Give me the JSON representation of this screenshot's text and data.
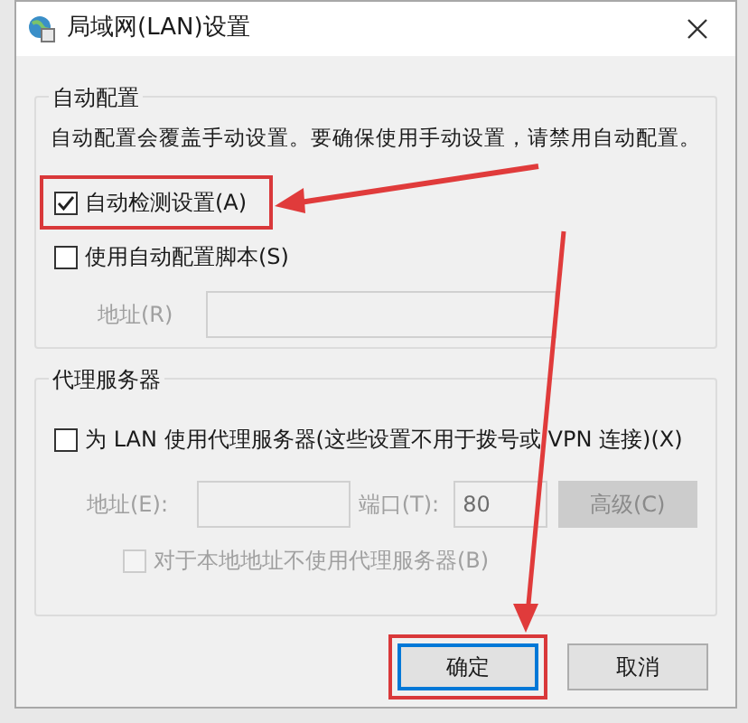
{
  "window": {
    "title": "局域网(LAN)设置"
  },
  "auto_config": {
    "title": "自动配置",
    "description": "自动配置会覆盖手动设置。要确保使用手动设置，请禁用自动配置。",
    "options": [
      {
        "label": "自动检测设置(A)",
        "checked": true,
        "highlighted": true
      },
      {
        "label": "使用自动配置脚本(S)",
        "checked": false,
        "highlighted": false
      }
    ],
    "address": {
      "label": "地址(R)",
      "disabled": true
    }
  },
  "proxy": {
    "title": "代理服务器",
    "use_proxy": {
      "label": "为 LAN 使用代理服务器(这些设置不用于拨号或 VPN 连接)(X)",
      "checked": false
    },
    "address": {
      "label": "地址(E):",
      "disabled": true
    },
    "port": {
      "label": "端口(T):",
      "value": "80",
      "disabled": true
    },
    "advanced": {
      "label": "高级(C)",
      "disabled": true
    },
    "bypass": {
      "label": "对于本地地址不使用代理服务器(B)",
      "checked": false,
      "disabled": true
    }
  },
  "buttons": [
    {
      "label": "确定",
      "focused": true,
      "highlighted": true
    },
    {
      "label": "取消",
      "focused": false,
      "highlighted": false
    }
  ]
}
